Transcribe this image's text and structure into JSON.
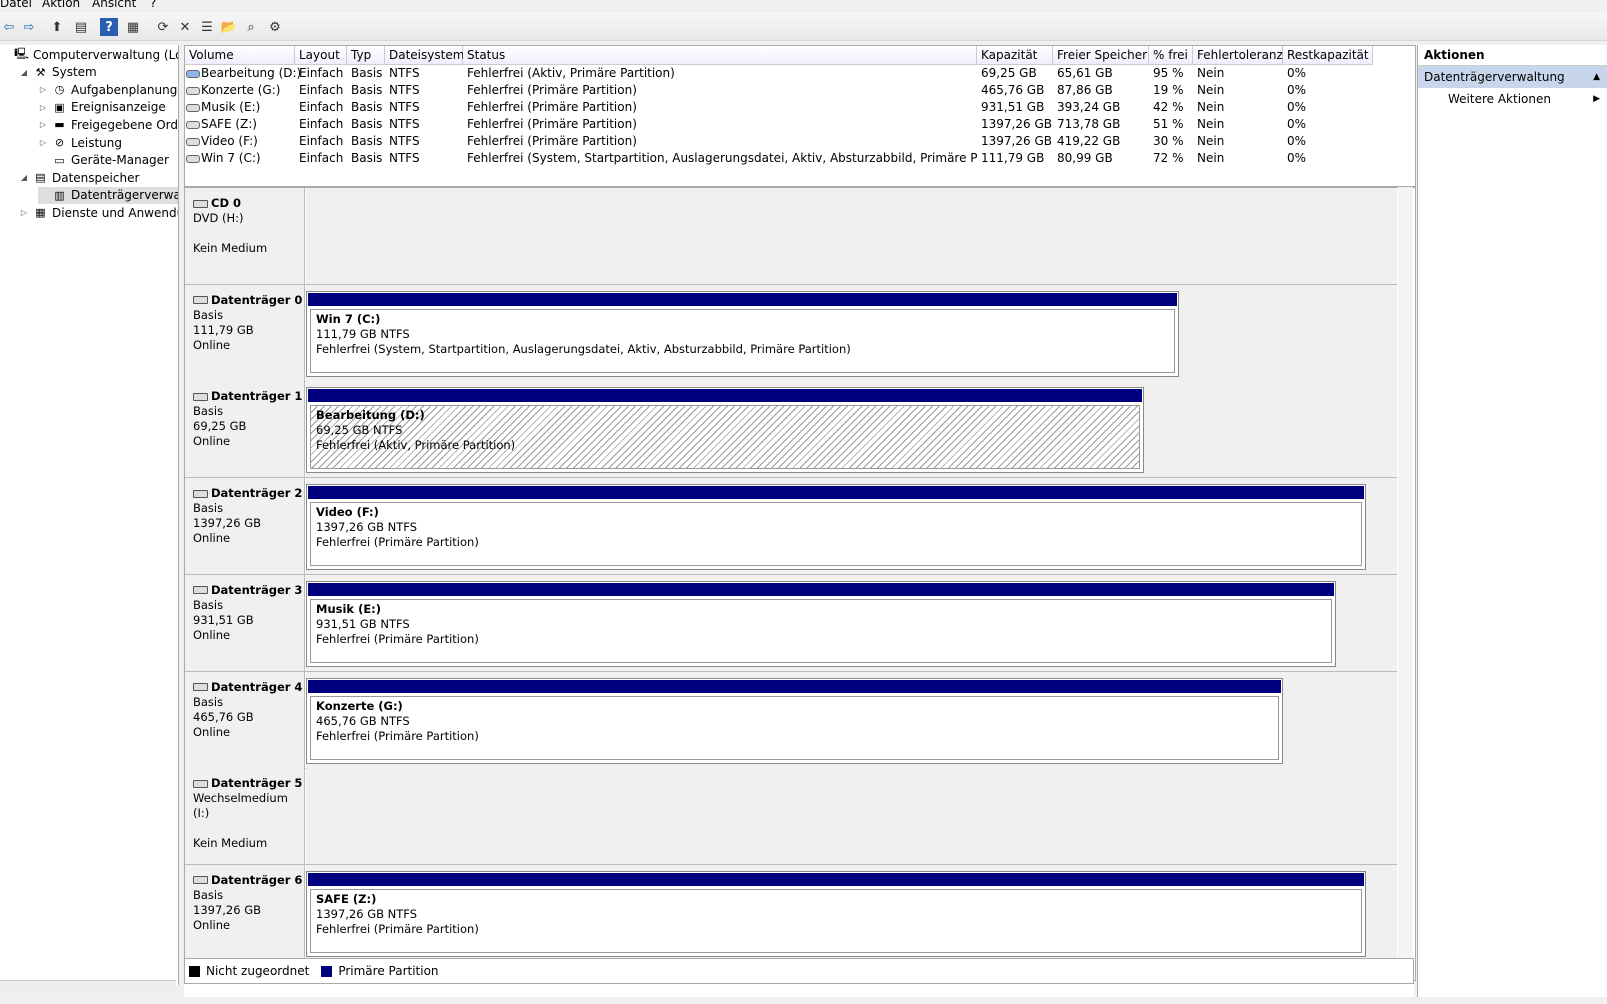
{
  "menu": [
    "Datei",
    "Aktion",
    "Ansicht",
    "?"
  ],
  "toolbar": [
    "back-icon",
    "forward-icon",
    "up-icon",
    "tree-icon",
    "help-icon",
    "panel-icon",
    "refresh-icon",
    "delete-icon",
    "properties-icon",
    "open-icon",
    "search-icon",
    "settings-icon"
  ],
  "tree": [
    {
      "label": "Computerverwaltung (Lokal)",
      "level": 0,
      "exp": "",
      "icon": "computer-icon",
      "sel": false
    },
    {
      "label": "System",
      "level": 1,
      "exp": "◢",
      "icon": "system-icon",
      "sel": false
    },
    {
      "label": "Aufgabenplanung",
      "level": 2,
      "exp": "▷",
      "icon": "clock-icon",
      "sel": false
    },
    {
      "label": "Ereignisanzeige",
      "level": 2,
      "exp": "▷",
      "icon": "event-icon",
      "sel": false
    },
    {
      "label": "Freigegebene Ordner",
      "level": 2,
      "exp": "▷",
      "icon": "folder-icon",
      "sel": false
    },
    {
      "label": "Leistung",
      "level": 2,
      "exp": "▷",
      "icon": "performance-icon",
      "sel": false
    },
    {
      "label": "Geräte-Manager",
      "level": 2,
      "exp": "",
      "icon": "device-manager-icon",
      "sel": false
    },
    {
      "label": "Datenspeicher",
      "level": 1,
      "exp": "◢",
      "icon": "storage-icon",
      "sel": false
    },
    {
      "label": "Datenträgerverwaltun",
      "level": 2,
      "exp": "",
      "icon": "disk-management-icon",
      "sel": true
    },
    {
      "label": "Dienste und Anwendunge",
      "level": 1,
      "exp": "▷",
      "icon": "services-icon",
      "sel": false
    }
  ],
  "volume_table": {
    "headers": [
      "Volume",
      "Layout",
      "Typ",
      "Dateisystem",
      "Status",
      "Kapazität",
      "Freier Speicher",
      "% frei",
      "Fehlertoleranz",
      "Restkapazität"
    ],
    "rows": [
      [
        "Bearbeitung (D:)",
        "Einfach",
        "Basis",
        "NTFS",
        "Fehlerfrei (Aktiv, Primäre Partition)",
        "69,25 GB",
        "65,61 GB",
        "95 %",
        "Nein",
        "0%"
      ],
      [
        "Konzerte (G:)",
        "Einfach",
        "Basis",
        "NTFS",
        "Fehlerfrei (Primäre Partition)",
        "465,76 GB",
        "87,86 GB",
        "19 %",
        "Nein",
        "0%"
      ],
      [
        "Musik (E:)",
        "Einfach",
        "Basis",
        "NTFS",
        "Fehlerfrei (Primäre Partition)",
        "931,51 GB",
        "393,24 GB",
        "42 %",
        "Nein",
        "0%"
      ],
      [
        "SAFE (Z:)",
        "Einfach",
        "Basis",
        "NTFS",
        "Fehlerfrei (Primäre Partition)",
        "1397,26 GB",
        "713,78 GB",
        "51 %",
        "Nein",
        "0%"
      ],
      [
        "Video (F:)",
        "Einfach",
        "Basis",
        "NTFS",
        "Fehlerfrei (Primäre Partition)",
        "1397,26 GB",
        "419,22 GB",
        "30 %",
        "Nein",
        "0%"
      ],
      [
        "Win 7 (C:)",
        "Einfach",
        "Basis",
        "NTFS",
        "Fehlerfrei (System, Startpartition, Auslagerungsdatei, Aktiv, Absturzabbild, Primäre Partition)",
        "111,79 GB",
        "80,99 GB",
        "72 %",
        "Nein",
        "0%"
      ]
    ]
  },
  "disks": [
    {
      "name": "CD 0",
      "line1": "DVD (H:)",
      "line2": "",
      "line3": "Kein Medium",
      "part": null
    },
    {
      "name": "Datenträger 0",
      "line1": "Basis",
      "line2": "111,79 GB",
      "line3": "Online",
      "part": {
        "title": "Win 7  (C:)",
        "size": "111,79 GB NTFS",
        "status": "Fehlerfrei (System, Startpartition, Auslagerungsdatei, Aktiv, Absturzabbild, Primäre Partition)",
        "hatch": false
      }
    },
    {
      "name": "Datenträger 1",
      "line1": "Basis",
      "line2": "69,25 GB",
      "line3": "Online",
      "part": {
        "title": "Bearbeitung  (D:)",
        "size": "69,25 GB NTFS",
        "status": "Fehlerfrei (Aktiv, Primäre Partition)",
        "hatch": true
      }
    },
    {
      "name": "Datenträger 2",
      "line1": "Basis",
      "line2": "1397,26 GB",
      "line3": "Online",
      "part": {
        "title": "Video  (F:)",
        "size": "1397,26 GB NTFS",
        "status": "Fehlerfrei (Primäre Partition)",
        "hatch": false
      }
    },
    {
      "name": "Datenträger 3",
      "line1": "Basis",
      "line2": "931,51 GB",
      "line3": "Online",
      "part": {
        "title": "Musik  (E:)",
        "size": "931,51 GB NTFS",
        "status": "Fehlerfrei (Primäre Partition)",
        "hatch": false
      }
    },
    {
      "name": "Datenträger 4",
      "line1": "Basis",
      "line2": "465,76 GB",
      "line3": "Online",
      "part": {
        "title": "Konzerte  (G:)",
        "size": "465,76 GB NTFS",
        "status": "Fehlerfrei (Primäre Partition)",
        "hatch": false
      }
    },
    {
      "name": "Datenträger 5",
      "line1": "Wechselmedium (I:)",
      "line2": "",
      "line3": "Kein Medium",
      "part": null
    },
    {
      "name": "Datenträger 6",
      "line1": "Basis",
      "line2": "1397,26 GB",
      "line3": "Online",
      "part": {
        "title": "SAFE  (Z:)",
        "size": "1397,26 GB NTFS",
        "status": "Fehlerfrei (Primäre Partition)",
        "hatch": false
      }
    }
  ],
  "legend": {
    "unallocated": "Nicht zugeordnet",
    "primary": "Primäre Partition",
    "unallocated_color": "#000000",
    "primary_color": "#00007f"
  },
  "actions": {
    "header": "Aktionen",
    "section": "Datenträgerverwaltung",
    "item": "Weitere Aktionen"
  }
}
